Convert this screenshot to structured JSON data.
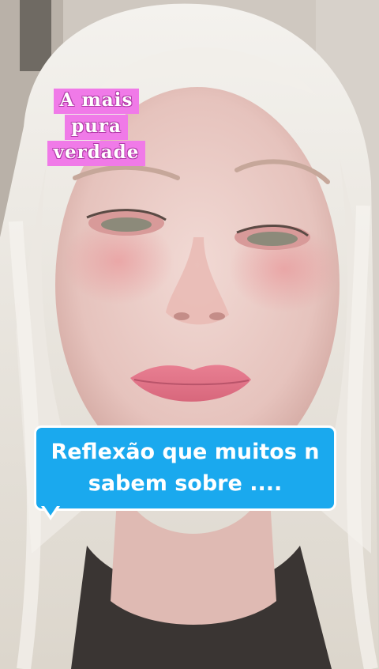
{
  "sticker": {
    "lines": [
      "A mais",
      "pura",
      "verdade"
    ],
    "color": "#f07ae8"
  },
  "caption": {
    "line1": "Reflexão que muitos n",
    "line2": "sabem sobre ....",
    "color": "#1aa9ee"
  }
}
